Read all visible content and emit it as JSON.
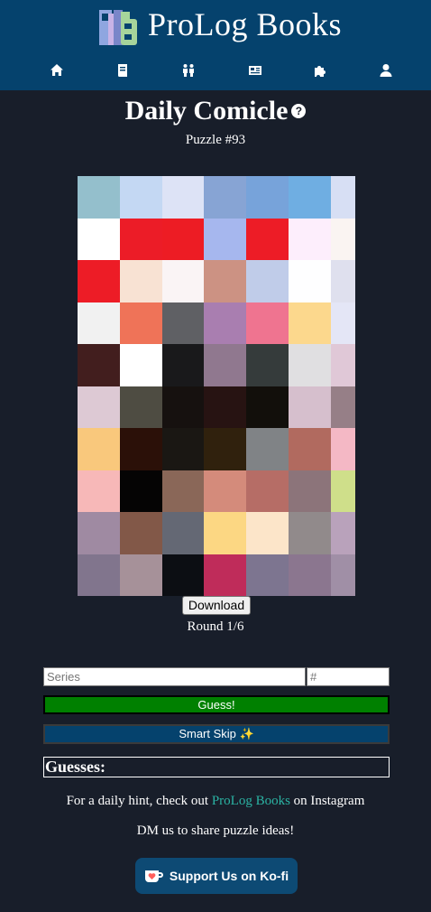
{
  "header": {
    "brand": "ProLog Books",
    "nav": [
      {
        "icon": "home-icon"
      },
      {
        "icon": "book-icon"
      },
      {
        "icon": "people-icon"
      },
      {
        "icon": "comic-icon"
      },
      {
        "icon": "puzzle-icon"
      },
      {
        "icon": "user-icon"
      }
    ]
  },
  "main": {
    "title": "Daily Comicle",
    "help": "?",
    "puzzle_number": "Puzzle #93",
    "download_label": "Download",
    "round": "Round 1/6",
    "series_placeholder": "Series",
    "number_placeholder": "#",
    "guess_label": "Guess!",
    "skip_label": "Smart Skip ✨",
    "guesses_label": "Guesses:",
    "hint_prefix": "For a daily hint, check out ",
    "hint_link": "ProLog Books",
    "hint_suffix": " on Instagram",
    "dm_text": "DM us to share puzzle ideas!",
    "kofi_label": "Support Us on Ko-fi"
  },
  "colors": {
    "header_bg": "#05426d",
    "page_bg": "#181e2a",
    "guess_green": "#008000",
    "link_teal": "#2bb3a3"
  },
  "pixel_grid": [
    [
      "#94bfcc",
      "#c4d8f3",
      "#dde3f6",
      "#87a4d4",
      "#77a3da",
      "#6faee2",
      "#d7dff4"
    ],
    [
      "#ffffff",
      "#ec1c27",
      "#ed1c24",
      "#a6b7ee",
      "#ed1c26",
      "#fdeefc",
      "#faf4f2"
    ],
    [
      "#ed1c26",
      "#f8e2d3",
      "#faf4f5",
      "#cc9283",
      "#c0cce9",
      "#fefeff",
      "#dfe0ee"
    ],
    [
      "#f1f1f1",
      "#ef7358",
      "#5f6064",
      "#a97eb0",
      "#ef7490",
      "#fcd88d",
      "#e4e6f6"
    ],
    [
      "#421e1e",
      "#ffffff",
      "#19191b",
      "#90788f",
      "#353b3b",
      "#e0dfe1",
      "#e0c8d7"
    ],
    [
      "#ddc9d4",
      "#4e4c42",
      "#16110f",
      "#271312",
      "#120f0b",
      "#d6bfcd",
      "#967f87"
    ],
    [
      "#f9c87c",
      "#2b1008",
      "#1a1713",
      "#30210d",
      "#808386",
      "#b16a5f",
      "#f4b8c5"
    ],
    [
      "#f7b8b8",
      "#050404",
      "#8a6758",
      "#d48b7b",
      "#b66d66",
      "#8c747a",
      "#cfdf8a"
    ],
    [
      "#9f8aa2",
      "#825848",
      "#646874",
      "#fcd783",
      "#fce5c9",
      "#918a8b",
      "#b9a2bb"
    ],
    [
      "#81758d",
      "#a69199",
      "#0c0e13",
      "#bf2c5a",
      "#7d7590",
      "#8b768f",
      "#a08fa6"
    ]
  ]
}
